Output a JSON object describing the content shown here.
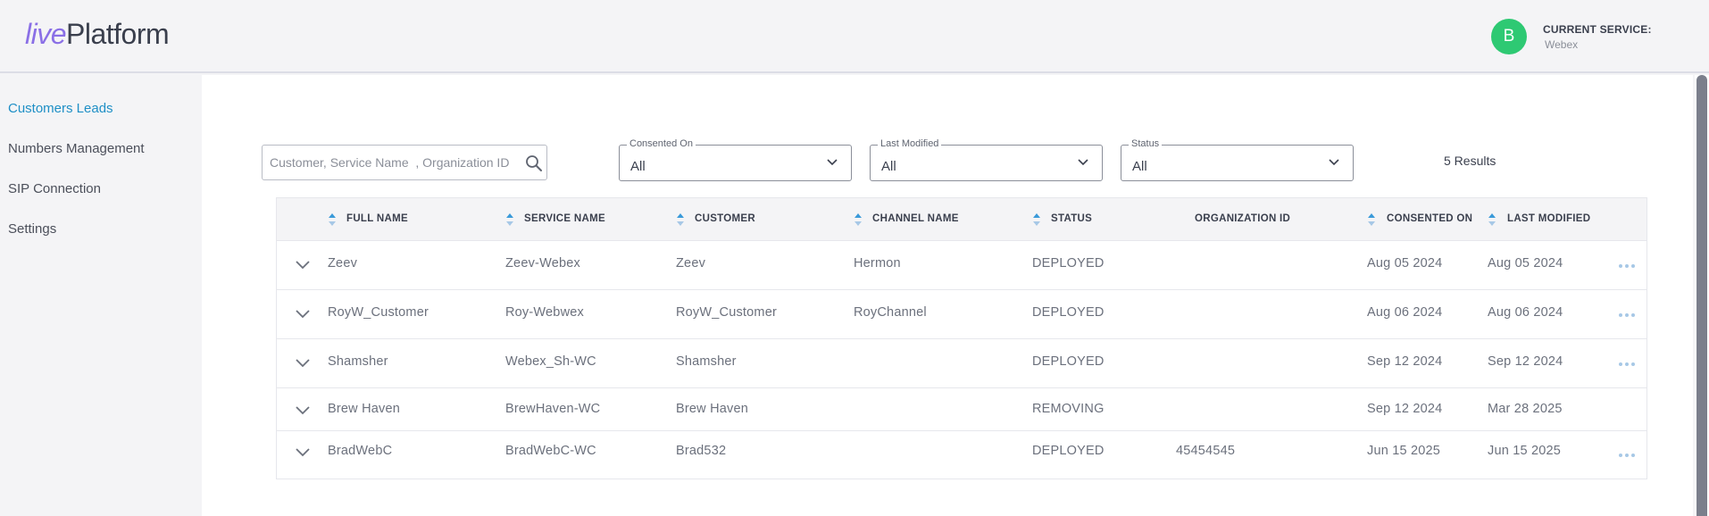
{
  "header": {
    "logo_live": "live",
    "logo_platform": "Platform",
    "avatar_initial": "B",
    "current_service_label": "CURRENT SERVICE:",
    "current_service_value": "Webex"
  },
  "sidebar": {
    "items": [
      {
        "label": "Customers Leads",
        "active": true
      },
      {
        "label": "Numbers Management",
        "active": false
      },
      {
        "label": "SIP Connection",
        "active": false
      },
      {
        "label": "Settings",
        "active": false
      }
    ]
  },
  "filters": {
    "search_placeholder": "Customer, Service Name  , Organization ID",
    "consented_on": {
      "label": "Consented On",
      "value": "All"
    },
    "last_modified": {
      "label": "Last Modified",
      "value": "All"
    },
    "status": {
      "label": "Status",
      "value": "All"
    },
    "results_text": "5 Results"
  },
  "table": {
    "columns": [
      "FULL NAME",
      "SERVICE NAME",
      "CUSTOMER",
      "CHANNEL NAME",
      "STATUS",
      "ORGANIZATION ID",
      "CONSENTED ON",
      "LAST MODIFIED"
    ],
    "rows": [
      {
        "full_name": "Zeev",
        "service_name": "Zeev-Webex",
        "customer": "Zeev",
        "channel_name": "Hermon",
        "status": "DEPLOYED",
        "organization_id": "",
        "consented_on": "Aug 05 2024",
        "last_modified": "Aug 05 2024",
        "has_menu": true
      },
      {
        "full_name": "RoyW_Customer",
        "service_name": "Roy-Webwex",
        "customer": "RoyW_Customer",
        "channel_name": "RoyChannel",
        "status": "DEPLOYED",
        "organization_id": "",
        "consented_on": "Aug 06 2024",
        "last_modified": "Aug 06 2024",
        "has_menu": true
      },
      {
        "full_name": "Shamsher",
        "service_name": "Webex_Sh-WC",
        "customer": "Shamsher",
        "channel_name": "",
        "status": "DEPLOYED",
        "organization_id": "",
        "consented_on": "Sep 12 2024",
        "last_modified": "Sep 12 2024",
        "has_menu": true
      },
      {
        "full_name": "Brew Haven",
        "service_name": "BrewHaven-WC",
        "customer": "Brew Haven",
        "channel_name": "",
        "status": "REMOVING",
        "organization_id": "",
        "consented_on": "Sep 12 2024",
        "last_modified": "Mar 28 2025",
        "has_menu": false
      },
      {
        "full_name": "BradWebC",
        "service_name": "BradWebC-WC",
        "customer": "Brad532",
        "channel_name": "",
        "status": "DEPLOYED",
        "organization_id": "45454545",
        "consented_on": "Jun 15 2025",
        "last_modified": "Jun 15 2025",
        "has_menu": true
      }
    ]
  },
  "colors": {
    "accent": "#1e8fc6",
    "avatar": "#2ec973",
    "sort_arrow": "#3a9ad9",
    "more_dots": "#a7c8e6"
  }
}
